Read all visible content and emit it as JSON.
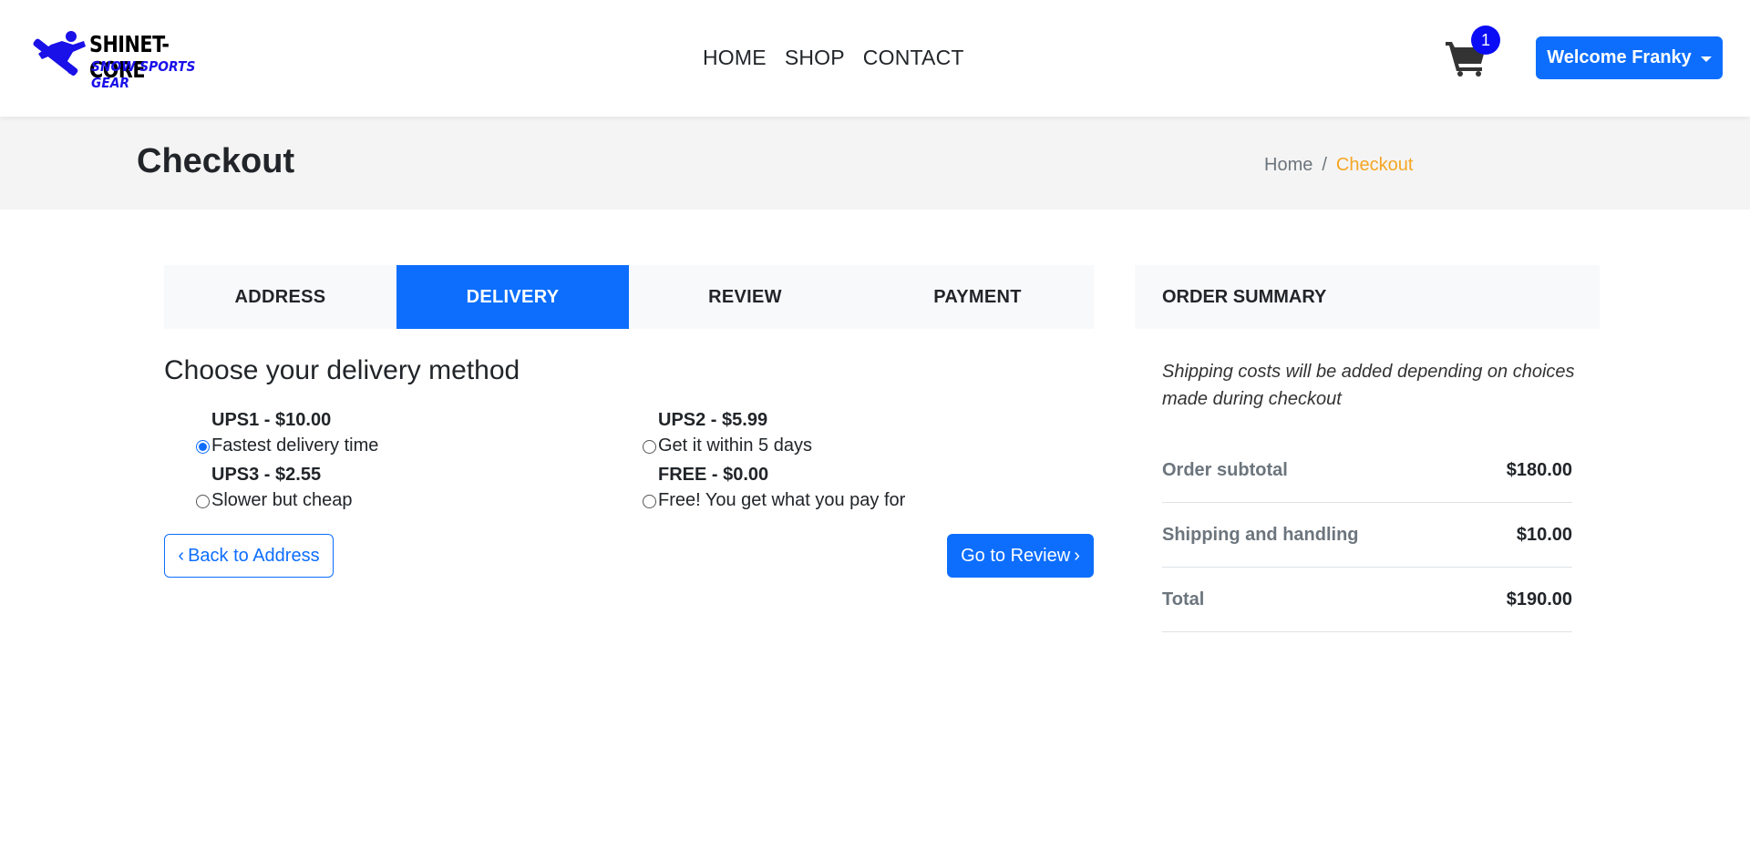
{
  "brand": {
    "name": "SHINET-CORE",
    "tagline": "SNOW SPORTS GEAR",
    "logo_color": "#1a10e8"
  },
  "nav": {
    "items": [
      "HOME",
      "SHOP",
      "CONTACT"
    ]
  },
  "cart": {
    "count": "1",
    "icon": "shopping-cart-icon"
  },
  "user": {
    "welcome_label": "Welcome Franky"
  },
  "page": {
    "title": "Checkout",
    "breadcrumb": {
      "home": "Home",
      "separator": "/",
      "current": "Checkout"
    }
  },
  "steps": {
    "tabs": [
      "ADDRESS",
      "DELIVERY",
      "REVIEW",
      "PAYMENT"
    ],
    "active": "DELIVERY"
  },
  "delivery": {
    "heading": "Choose your delivery method",
    "options": [
      {
        "name": "UPS1 - $10.00",
        "description": "Fastest delivery time",
        "selected": true
      },
      {
        "name": "UPS2 - $5.99",
        "description": "Get it within 5 days",
        "selected": false
      },
      {
        "name": "UPS3 - $2.55",
        "description": "Slower but cheap",
        "selected": false
      },
      {
        "name": "FREE - $0.00",
        "description": "Free! You get what you pay for",
        "selected": false
      }
    ],
    "back_label": "Back to Address",
    "next_label": "Go to Review"
  },
  "summary": {
    "heading": "ORDER SUMMARY",
    "note": "Shipping costs will be added depending on choices made during checkout",
    "rows": [
      {
        "label": "Order subtotal",
        "value": "$180.00"
      },
      {
        "label": "Shipping and handling",
        "value": "$10.00"
      },
      {
        "label": "Total",
        "value": "$190.00"
      }
    ]
  },
  "colors": {
    "primary": "#0d6efd",
    "breadcrumb_active": "#f5a623",
    "badge": "#0a0cf5"
  }
}
